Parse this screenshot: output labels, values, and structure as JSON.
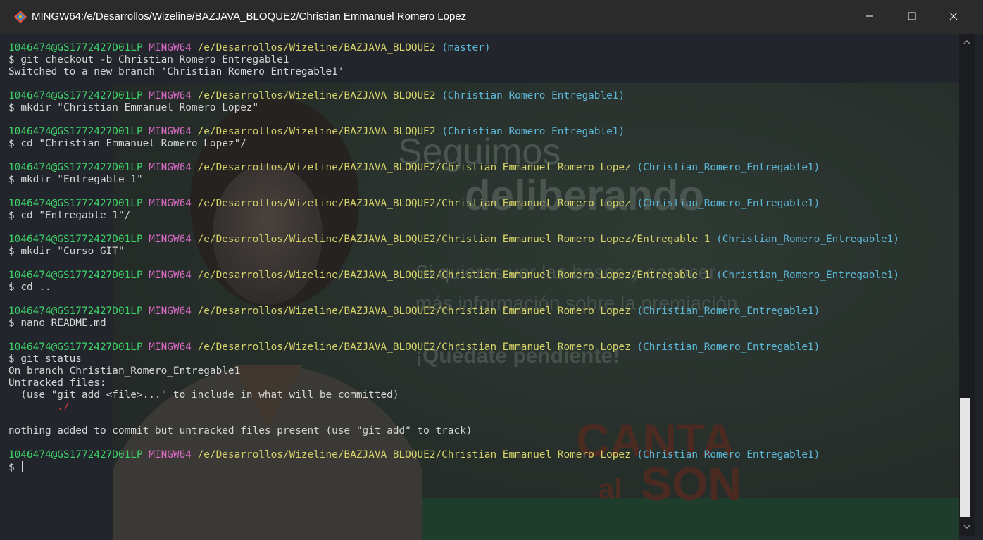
{
  "window": {
    "title": "MINGW64:/e/Desarrollos/Wizeline/BAZJAVA_BLOQUE2/Christian Emmanuel Romero Lopez",
    "icon": "git-bash-icon",
    "controls": [
      "minimize-icon",
      "maximize-icon",
      "close-icon"
    ]
  },
  "background_image": {
    "headline": [
      "Seguimos",
      "deliberando"
    ],
    "body": [
      "Si quieres ver las bases y conocer",
      "más información sobre la premiación",
      "¡Quédate pendiente!"
    ],
    "logo_text": [
      "CANTA",
      "al",
      "SON"
    ]
  },
  "colors": {
    "user_host": "#3fd26a",
    "system": "#d86ac4",
    "path": "#d6d36a",
    "branch": "#5db8d8",
    "untracked": "#d23f3f"
  },
  "terminal": {
    "prompts": [
      {
        "user": "1046474@GS1772427D01LP",
        "sys": "MINGW64",
        "path": "/e/Desarrollos/Wizeline/BAZJAVA_BLOQUE2",
        "branch": "(master)",
        "cmd": "$ git checkout -b Christian_Romero_Entregable1",
        "output": [
          "Switched to a new branch 'Christian_Romero_Entregable1'"
        ]
      },
      {
        "user": "1046474@GS1772427D01LP",
        "sys": "MINGW64",
        "path": "/e/Desarrollos/Wizeline/BAZJAVA_BLOQUE2",
        "branch": "(Christian_Romero_Entregable1)",
        "cmd": "$ mkdir \"Christian Emmanuel Romero Lopez\"",
        "output": []
      },
      {
        "user": "1046474@GS1772427D01LP",
        "sys": "MINGW64",
        "path": "/e/Desarrollos/Wizeline/BAZJAVA_BLOQUE2",
        "branch": "(Christian_Romero_Entregable1)",
        "cmd": "$ cd \"Christian Emmanuel Romero Lopez\"/",
        "output": []
      },
      {
        "user": "1046474@GS1772427D01LP",
        "sys": "MINGW64",
        "path": "/e/Desarrollos/Wizeline/BAZJAVA_BLOQUE2/Christian Emmanuel Romero Lopez",
        "branch": "(Christian_Romero_Entregable1)",
        "cmd": "$ mkdir \"Entregable 1\"",
        "output": []
      },
      {
        "user": "1046474@GS1772427D01LP",
        "sys": "MINGW64",
        "path": "/e/Desarrollos/Wizeline/BAZJAVA_BLOQUE2/Christian Emmanuel Romero Lopez",
        "branch": "(Christian_Romero_Entregable1)",
        "cmd": "$ cd \"Entregable 1\"/",
        "output": []
      },
      {
        "user": "1046474@GS1772427D01LP",
        "sys": "MINGW64",
        "path": "/e/Desarrollos/Wizeline/BAZJAVA_BLOQUE2/Christian Emmanuel Romero Lopez/Entregable 1",
        "branch": "(Christian_Romero_Entregable1)",
        "cmd": "$ mkdir \"Curso GIT\"",
        "output": []
      },
      {
        "user": "1046474@GS1772427D01LP",
        "sys": "MINGW64",
        "path": "/e/Desarrollos/Wizeline/BAZJAVA_BLOQUE2/Christian Emmanuel Romero Lopez/Entregable 1",
        "branch": "(Christian_Romero_Entregable1)",
        "cmd": "$ cd ..",
        "output": []
      },
      {
        "user": "1046474@GS1772427D01LP",
        "sys": "MINGW64",
        "path": "/e/Desarrollos/Wizeline/BAZJAVA_BLOQUE2/Christian Emmanuel Romero Lopez",
        "branch": "(Christian_Romero_Entregable1)",
        "cmd": "$ nano README.md",
        "output": []
      },
      {
        "user": "1046474@GS1772427D01LP",
        "sys": "MINGW64",
        "path": "/e/Desarrollos/Wizeline/BAZJAVA_BLOQUE2/Christian Emmanuel Romero Lopez",
        "branch": "(Christian_Romero_Entregable1)",
        "cmd": "$ git status",
        "output": [
          "On branch Christian_Romero_Entregable1",
          "Untracked files:",
          "  (use \"git add <file>...\" to include in what will be committed)",
          "        ./",
          "",
          "nothing added to commit but untracked files present (use \"git add\" to track)"
        ]
      },
      {
        "user": "1046474@GS1772427D01LP",
        "sys": "MINGW64",
        "path": "/e/Desarrollos/Wizeline/BAZJAVA_BLOQUE2/Christian Emmanuel Romero Lopez",
        "branch": "(Christian_Romero_Entregable1)",
        "cmd": "$ ",
        "output": []
      }
    ]
  }
}
